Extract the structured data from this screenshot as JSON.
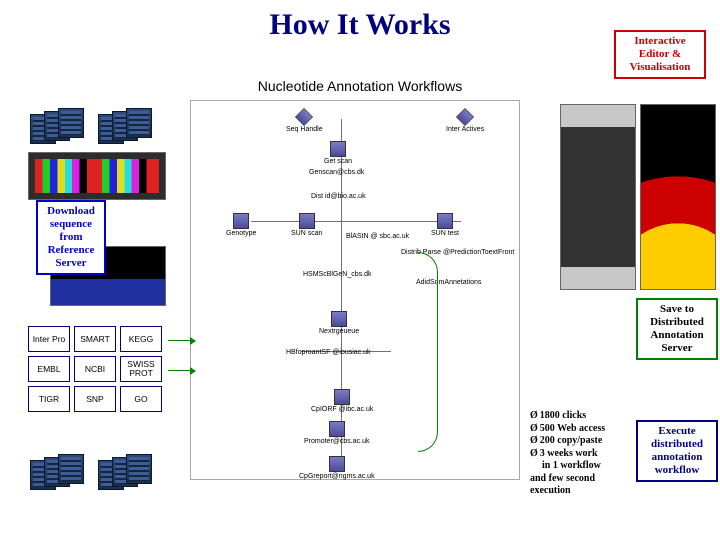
{
  "title": "How It Works",
  "subtitle": "Nucleotide Annotation Workflows",
  "boxes": {
    "editor": "Interactive\nEditor &\nVisualisation",
    "download": "Download\nsequence\nfrom\nReference\nServer",
    "save": "Save to\nDistributed\nAnnotation\nServer",
    "execute": "Execute\ndistributed\nannotation\nworkflow"
  },
  "db": {
    "r0c0": "Inter Pro",
    "r0c1": "SMART",
    "r0c2": "KEGG",
    "r1c0": "EMBL",
    "r1c1": "NCBI",
    "r1c2": "SWISS PROT",
    "r2c0": "TIGR",
    "r2c1": "SNP",
    "r2c2": "GO"
  },
  "stats": {
    "s0": "1800 clicks",
    "s1": "500 Web access",
    "s2": "200 copy/paste",
    "s3": "3 weeks work",
    "tail1": "in 1 workflow",
    "tail2": "and few second",
    "tail3": "execution"
  },
  "wf": {
    "n0": "Seq Handle",
    "n1": "Inter Actives",
    "n2": "Get scan",
    "n3": "Genscan@cbs.dk",
    "n4": "Dist id@bio.ac.uk",
    "n5": "Genotype",
    "n6": "SUN scan",
    "n7": "BlAStN @ sbc.ac.uk",
    "n8": "SUN test",
    "n9": "Distrib Parse @PredictionToextFront",
    "n10": "HSMScBlGeN_cbs.dk",
    "n11": "AdidSomAnnetations",
    "n12": "Nextrgeueue",
    "n13": "HBfoproantSF @iousiac.uk",
    "n14": "CpIORF @ibc.ac.uk",
    "n15": "Promoter@cbs.ac.uk",
    "n16": "CpGreport@ngms.ac.uk"
  }
}
